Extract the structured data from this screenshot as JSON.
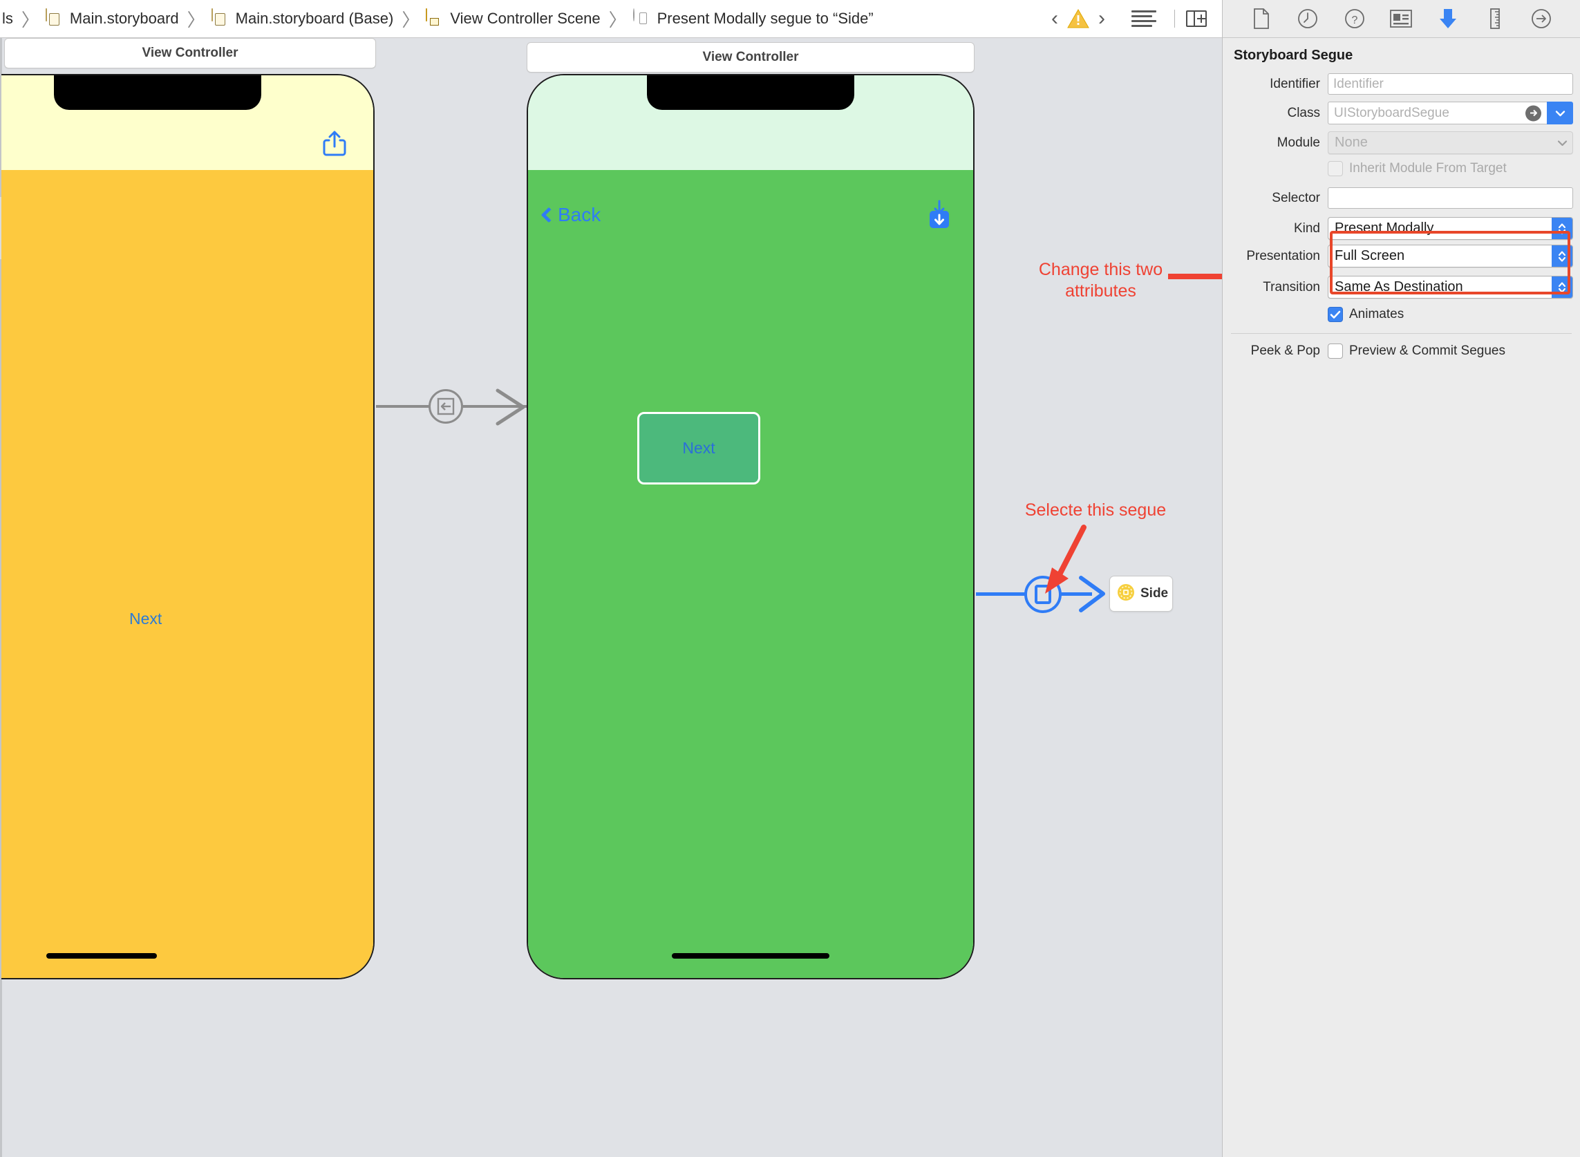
{
  "breadcrumb": {
    "items": [
      {
        "label": "ls",
        "icon": "none"
      },
      {
        "label": "Main.storyboard",
        "icon": "storyboard-file-icon"
      },
      {
        "label": "Main.storyboard (Base)",
        "icon": "storyboard-base-file-icon"
      },
      {
        "label": "View Controller Scene",
        "icon": "view-controller-scene-icon"
      },
      {
        "label": "Present Modally segue to “Side”",
        "icon": "segue-icon"
      }
    ],
    "separator": "〉",
    "tools": {
      "back_label": "‹",
      "forward_label": "›",
      "warning_icon": "warning-triangle-icon",
      "view_mode_icon": "document-outline-icon",
      "panel_toggle_icon": "toggle-inspector-icon"
    }
  },
  "canvas": {
    "scene1": {
      "title": "View Controller",
      "nav_bar_color": "#FEFFCC",
      "body_color": "#FDC93F",
      "button_label": "Next",
      "right_bar_item_icon": "share-icon"
    },
    "scene2": {
      "title": "View Controller",
      "nav_bar_color": "#DDF8E4",
      "body_color": "#5CC75C",
      "back_label": "Back",
      "right_bar_item_icon": "download-icon",
      "button_label": "Next",
      "button_selected": true
    },
    "destination_badge": {
      "label": "Side",
      "icon": "side-placeholder-icon"
    },
    "segue1": {
      "icon": "show-segue-icon",
      "color": "#8C8C8C",
      "selected": false
    },
    "segue2": {
      "icon": "present-modally-segue-icon",
      "color": "#2F7CF6",
      "selected": true
    },
    "annotations": [
      {
        "name": "change-attributes-note",
        "text_line1": "Change this two",
        "text_line2": "attributes",
        "color": "#EF4233"
      },
      {
        "name": "select-segue-note",
        "text_line1": "Selecte this segue",
        "text_line2": "",
        "color": "#EF4233"
      }
    ]
  },
  "inspector": {
    "tabs": [
      {
        "name": "file-inspector",
        "icon": "file-icon",
        "active": false
      },
      {
        "name": "history-inspector",
        "icon": "clock-icon",
        "active": false
      },
      {
        "name": "quick-help-inspector",
        "icon": "question-mark-icon",
        "active": false
      },
      {
        "name": "identity-inspector",
        "icon": "id-card-icon",
        "active": false
      },
      {
        "name": "attributes-inspector",
        "icon": "down-arrow-slider-icon",
        "active": true
      },
      {
        "name": "size-inspector",
        "icon": "ruler-icon",
        "active": false
      },
      {
        "name": "connections-inspector",
        "icon": "arrow-in-circle-icon",
        "active": false
      }
    ],
    "title": "Storyboard Segue",
    "fields": {
      "identifier_label": "Identifier",
      "identifier_value": "",
      "identifier_placeholder": "Identifier",
      "class_label": "Class",
      "class_value": "UIStoryboardSegue",
      "module_label": "Module",
      "module_value": "None",
      "inherit_module_label": "Inherit Module From Target",
      "inherit_module_checked": false,
      "selector_label": "Selector",
      "selector_value": "",
      "kind_label": "Kind",
      "kind_value": "Present Modally",
      "presentation_label": "Presentation",
      "presentation_value": "Full Screen",
      "transition_label": "Transition",
      "transition_value": "Same As Destination",
      "animates_label": "Animates",
      "animates_checked": true,
      "peek_pop_label": "Peek & Pop",
      "preview_commit_label": "Preview & Commit Segues",
      "preview_commit_checked": false
    },
    "highlight_color": "#E8472A",
    "accent_color": "#3A84F3"
  }
}
